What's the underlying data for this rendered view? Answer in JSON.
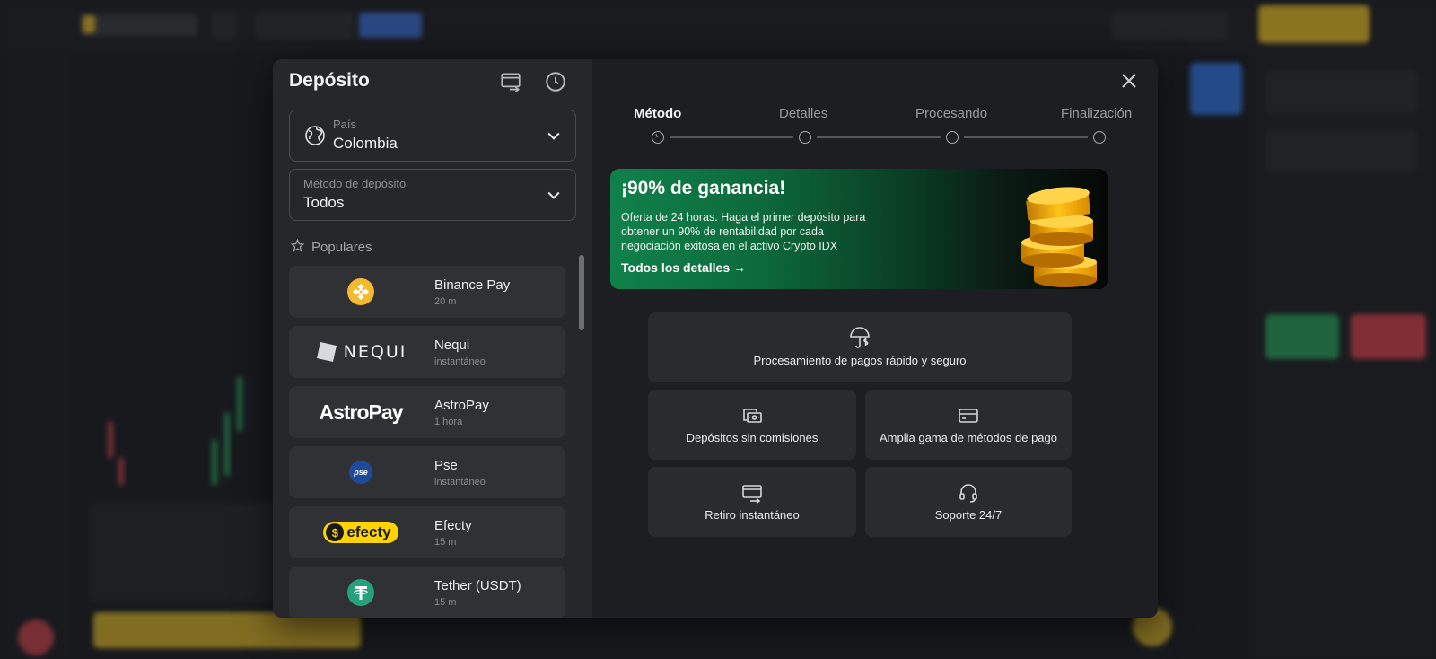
{
  "modal": {
    "title": "Depósito",
    "close_icon": "close-icon",
    "header_icons": [
      "transfer-icon",
      "history-clock-icon"
    ]
  },
  "country": {
    "label": "País",
    "value": "Colombia",
    "icon": "globe-icon"
  },
  "deposit_method": {
    "label": "Método de depósito",
    "value": "Todos"
  },
  "popular_label": "Populares",
  "methods": [
    {
      "name": "Binance Pay",
      "time": "20 m",
      "logo": "binance-logo"
    },
    {
      "name": "Nequi",
      "time": "instantáneo",
      "logo": "nequi-logo",
      "logo_text": "NEQUI"
    },
    {
      "name": "AstroPay",
      "time": "1 hora",
      "logo": "astropay-logo",
      "logo_text": "AstroPay"
    },
    {
      "name": "Pse",
      "time": "instantáneo",
      "logo": "pse-logo",
      "logo_text": "pse"
    },
    {
      "name": "Efecty",
      "time": "15 m",
      "logo": "efecty-logo",
      "logo_text": "efecty"
    },
    {
      "name": "Tether (USDT)",
      "time": "15 m",
      "logo": "tether-logo"
    }
  ],
  "steps": [
    {
      "label": "Método",
      "active": true
    },
    {
      "label": "Detalles",
      "active": false
    },
    {
      "label": "Procesando",
      "active": false
    },
    {
      "label": "Finalización",
      "active": false
    }
  ],
  "promo": {
    "title": "¡90% de ganancia!",
    "text": "Oferta de 24 horas. Haga el primer depósito para obtener un 90% de rentabilidad por cada negociación exitosa en el activo Crypto IDX",
    "link": "Todos los detalles →"
  },
  "features": [
    {
      "text": "Procesamiento de pagos rápido y seguro",
      "icon": "umbrella-dollar-icon"
    },
    {
      "text": "Depósitos sin comisiones",
      "icon": "cash-icon"
    },
    {
      "text": "Amplia gama de métodos de pago",
      "icon": "credit-card-icon"
    },
    {
      "text": "Retiro instantáneo",
      "icon": "withdraw-icon"
    },
    {
      "text": "Soporte 24/7",
      "icon": "headset-icon"
    }
  ],
  "colors": {
    "modal_bg": "#1d1e22",
    "panel_bg": "#26272b",
    "card_bg": "#303135",
    "promo_green": "#10814a",
    "binance_yellow": "#f3ba2f",
    "efecty_yellow": "#ffd400",
    "tether_teal": "#26a17b"
  }
}
